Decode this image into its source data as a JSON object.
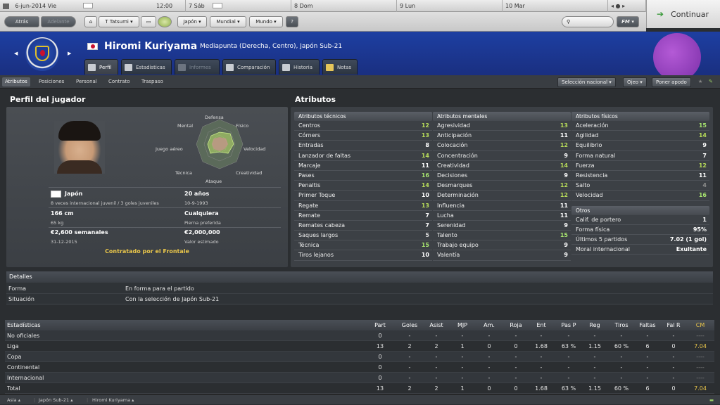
{
  "topbar": {
    "date": "6-jun-2014 Vie",
    "time": "12:00",
    "days": [
      "7 Sáb",
      "8 Dom",
      "9 Lun",
      "10 Mar"
    ],
    "continue_label": "Continuar"
  },
  "nav": {
    "back": "Atrás",
    "forward": "Adelante",
    "manager": "T Tatsumi",
    "menus": [
      "Japón",
      "Mundial",
      "Mundo"
    ],
    "help": "?",
    "fm": "FM"
  },
  "player": {
    "name": "Hiromi Kuriyama",
    "position": "Mediapunta (Derecha, Centro), Japón Sub-21",
    "tabs": [
      "Perfil",
      "Estadísticas",
      "Informes",
      "Comparación",
      "Historia",
      "Notas"
    ],
    "subtabs": [
      "Atributos",
      "Posiciones",
      "Personal",
      "Contrato",
      "Traspaso"
    ],
    "actions": [
      "Selección nacional",
      "Ojeo",
      "Poner apodo"
    ]
  },
  "profile": {
    "title": "Perfil del jugador",
    "radar_labels": [
      "Defensa",
      "Físico",
      "Velocidad",
      "Creatividad",
      "Ataque",
      "Técnica",
      "Juego aéreo",
      "Mental"
    ],
    "nation": "Japón",
    "caps": "8 veces internacional juvenil / 3 goles juveniles",
    "age": "20 años",
    "dob": "10-9-1993",
    "height": "166 cm",
    "weight": "65 kg",
    "foot": "Cualquiera",
    "foot_label": "Pierna preferida",
    "wage": "€2,600 semanales",
    "contract_end": "31-12-2015",
    "value": "€2,000,000",
    "value_label": "Valor estimado",
    "contract_status": "Contratado por el Frontale"
  },
  "attributes": {
    "title": "Atributos",
    "technical_title": "Atributos técnicos",
    "mental_title": "Atributos mentales",
    "physical_title": "Atributos físicos",
    "others_title": "Otros",
    "technical": [
      {
        "name": "Centros",
        "value": "12"
      },
      {
        "name": "Córners",
        "value": "13"
      },
      {
        "name": "Entradas",
        "value": "8"
      },
      {
        "name": "Lanzador de faltas",
        "value": "14"
      },
      {
        "name": "Marcaje",
        "value": "11"
      },
      {
        "name": "Pases",
        "value": "16"
      },
      {
        "name": "Penaltis",
        "value": "14"
      },
      {
        "name": "Primer Toque",
        "value": "10"
      },
      {
        "name": "Regate",
        "value": "13"
      },
      {
        "name": "Remate",
        "value": "7"
      },
      {
        "name": "Remates cabeza",
        "value": "7"
      },
      {
        "name": "Saques largos",
        "value": "5"
      },
      {
        "name": "Técnica",
        "value": "15"
      },
      {
        "name": "Tiros lejanos",
        "value": "10"
      }
    ],
    "mental": [
      {
        "name": "Agresividad",
        "value": "13"
      },
      {
        "name": "Anticipación",
        "value": "11"
      },
      {
        "name": "Colocación",
        "value": "12"
      },
      {
        "name": "Concentración",
        "value": "9"
      },
      {
        "name": "Creatividad",
        "value": "14"
      },
      {
        "name": "Decisiones",
        "value": "9"
      },
      {
        "name": "Desmarques",
        "value": "12"
      },
      {
        "name": "Determinación",
        "value": "12"
      },
      {
        "name": "Influencia",
        "value": "11"
      },
      {
        "name": "Lucha",
        "value": "11"
      },
      {
        "name": "Serenidad",
        "value": "9"
      },
      {
        "name": "Talento",
        "value": "15"
      },
      {
        "name": "Trabajo equipo",
        "value": "9"
      },
      {
        "name": "Valentía",
        "value": "9"
      }
    ],
    "physical": [
      {
        "name": "Aceleración",
        "value": "15"
      },
      {
        "name": "Agilidad",
        "value": "14"
      },
      {
        "name": "Equilibrio",
        "value": "9"
      },
      {
        "name": "Forma natural",
        "value": "7"
      },
      {
        "name": "Fuerza",
        "value": "12"
      },
      {
        "name": "Resistencia",
        "value": "11"
      },
      {
        "name": "Salto",
        "value": "4"
      },
      {
        "name": "Velocidad",
        "value": "16"
      }
    ],
    "others": [
      {
        "name": "Calif. de portero",
        "value": "1"
      },
      {
        "name": "Forma física",
        "value": "95%"
      },
      {
        "name": "Últimos 5 partidos",
        "value": "7.02 (1 gol)"
      },
      {
        "name": "Moral internacional",
        "value": "Exultante"
      }
    ]
  },
  "details": {
    "title": "Detalles",
    "rows": [
      {
        "label": "Forma",
        "value": "En forma para el partido"
      },
      {
        "label": "Situación",
        "value": "Con la selección de Japón Sub-21"
      }
    ]
  },
  "stats": {
    "title": "Estadísticas",
    "columns": [
      "Part",
      "Goles",
      "Asist",
      "MJP",
      "Am.",
      "Roja",
      "Ent",
      "Pas P",
      "Reg",
      "Tiros",
      "Faltas",
      "Fal R",
      "CM"
    ],
    "rows": [
      {
        "label": "No oficiales",
        "cells": [
          "0",
          "-",
          "-",
          "-",
          "-",
          "-",
          "-",
          "-",
          "-",
          "-",
          "-",
          "-",
          "----"
        ]
      },
      {
        "label": "Liga",
        "cells": [
          "13",
          "2",
          "2",
          "1",
          "0",
          "0",
          "1.68",
          "63 %",
          "1.15",
          "60 %",
          "6",
          "0",
          "7.04"
        ]
      },
      {
        "label": "Copa",
        "cells": [
          "0",
          "-",
          "-",
          "-",
          "-",
          "-",
          "-",
          "-",
          "-",
          "-",
          "-",
          "-",
          "----"
        ]
      },
      {
        "label": "Continental",
        "cells": [
          "0",
          "-",
          "-",
          "-",
          "-",
          "-",
          "-",
          "-",
          "-",
          "-",
          "-",
          "-",
          "----"
        ]
      },
      {
        "label": "Internacional",
        "cells": [
          "0",
          "-",
          "-",
          "-",
          "-",
          "-",
          "-",
          "-",
          "-",
          "-",
          "-",
          "-",
          "----"
        ]
      },
      {
        "label": "Total",
        "cells": [
          "13",
          "2",
          "2",
          "1",
          "0",
          "0",
          "1.68",
          "63 %",
          "1.15",
          "60 %",
          "6",
          "0",
          "7.04"
        ]
      }
    ]
  },
  "footer": {
    "crumbs": [
      "Asia",
      "Japón Sub-21",
      "Hiromi Kuriyama"
    ]
  },
  "colors": {
    "header_blue": "#1d3fa2",
    "accent_yellow": "#e8c54a",
    "good_green": "#a7e36f"
  }
}
